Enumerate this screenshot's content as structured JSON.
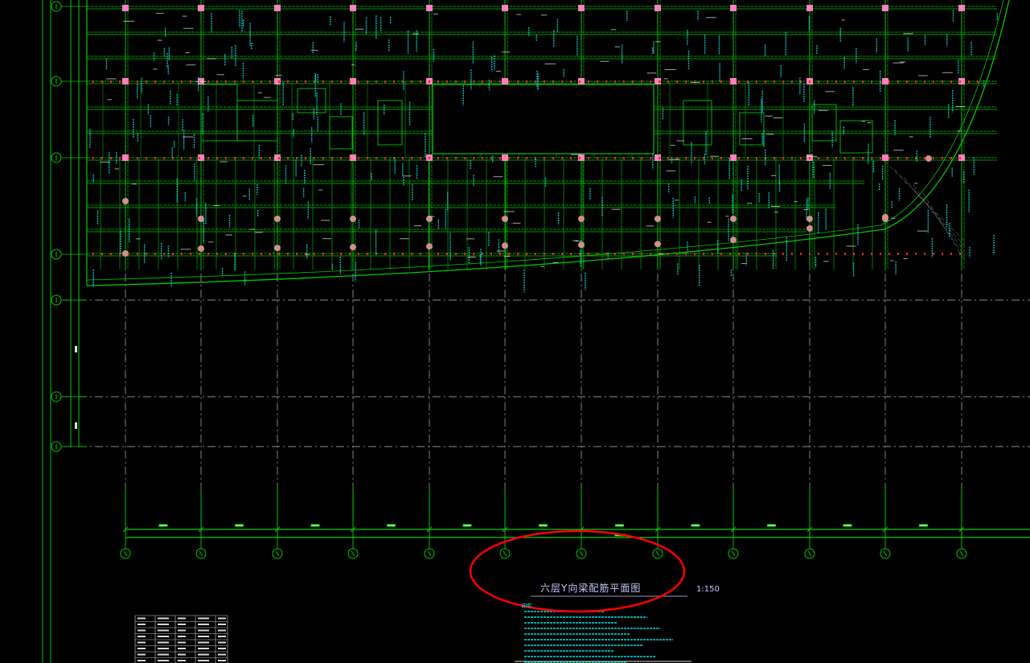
{
  "drawing": {
    "title": "六层Y向梁配筋平面图",
    "scale": "1:150",
    "notes_heading": "说明：",
    "colors": {
      "background": "#000000",
      "grid": "#00c800",
      "axis_dashed": "#e6e6e6",
      "beam_text": "#00ffff",
      "column": "#ff80c0",
      "annotation": "#ff0000",
      "dimension": "#00ff00",
      "title_text": "#c8c8ff"
    }
  },
  "annotation": {
    "type": "ellipse-highlight",
    "color": "#ff0000",
    "target": "drawing-title"
  }
}
